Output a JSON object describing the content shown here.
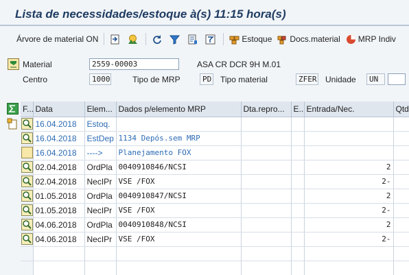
{
  "header": {
    "title": "Lista de necessidades/estoque à(s) 11:15 hora(s)"
  },
  "toolbar": {
    "buttons": [
      {
        "label": "Árvore de material ON",
        "icon": ""
      },
      {
        "label": "",
        "icon": "expand-icon"
      },
      {
        "label": "",
        "icon": "planning-icon"
      },
      {
        "label": "",
        "icon": "refresh-icon"
      },
      {
        "label": "",
        "icon": "filter-icon"
      },
      {
        "label": "",
        "icon": "list-settings-icon"
      },
      {
        "label": "",
        "icon": "sum-filter-icon"
      },
      {
        "label": "Estoque",
        "icon": "stock-icon"
      },
      {
        "label": "Docs.material",
        "icon": "documents-icon"
      },
      {
        "label": "MRP Indiv",
        "icon": "mrp-icon"
      }
    ]
  },
  "form": {
    "material_label": "Material",
    "material_value": "2559-00003",
    "material_desc": "ASA CR DCR 9H M.01",
    "centro_label": "Centro",
    "centro_value": "1000",
    "tipo_mrp_label": "Tipo de MRP",
    "tipo_mrp_value": "PD",
    "tipo_material_label": "Tipo material",
    "tipo_material_value": "ZFER",
    "unidade_label": "Unidade",
    "unidade_value": "UN"
  },
  "grid": {
    "columns": [
      "F...",
      "Data",
      "Elem...",
      "Dados p/elemento MRP",
      "Dta.repro...",
      "E...",
      "Entrada/Nec.",
      "Qtd"
    ],
    "rows": [
      {
        "icon": "magnifier-icon",
        "date": "16.04.2018",
        "elem": "Estoq.",
        "dados": "",
        "dta": "",
        "e": "",
        "qty": "",
        "style": "blue"
      },
      {
        "icon": "magnifier-icon",
        "date": "16.04.2018",
        "elem": "EstDep",
        "dados": "1134 Depós.sem MRP",
        "dta": "",
        "e": "",
        "qty": "",
        "style": "blue"
      },
      {
        "icon": "blank-icon",
        "date": "16.04.2018",
        "elem": "---->",
        "dados": "Planejamento FOX",
        "dta": "",
        "e": "",
        "qty": "",
        "style": "blue"
      },
      {
        "icon": "magnifier-icon",
        "date": "02.04.2018",
        "elem": "OrdPla",
        "dados": "0040910846/NCSI",
        "dta": "",
        "e": "",
        "qty": "2",
        "style": "normal"
      },
      {
        "icon": "magnifier-icon",
        "date": "02.04.2018",
        "elem": "NecIPr",
        "dados": "VSE /FOX",
        "dta": "",
        "e": "",
        "qty": "2-",
        "style": "normal"
      },
      {
        "icon": "magnifier-icon",
        "date": "01.05.2018",
        "elem": "OrdPla",
        "dados": "0040910847/NCSI",
        "dta": "",
        "e": "",
        "qty": "2",
        "style": "normal"
      },
      {
        "icon": "magnifier-icon",
        "date": "01.05.2018",
        "elem": "NecIPr",
        "dados": "VSE /FOX",
        "dta": "",
        "e": "",
        "qty": "2-",
        "style": "normal"
      },
      {
        "icon": "magnifier-icon",
        "date": "04.06.2018",
        "elem": "OrdPla",
        "dados": "0040910848/NCSI",
        "dta": "",
        "e": "",
        "qty": "2",
        "style": "normal"
      },
      {
        "icon": "magnifier-icon",
        "date": "04.06.2018",
        "elem": "NecIPr",
        "dados": "VSE /FOX",
        "dta": "",
        "e": "",
        "qty": "2-",
        "style": "normal"
      }
    ]
  }
}
